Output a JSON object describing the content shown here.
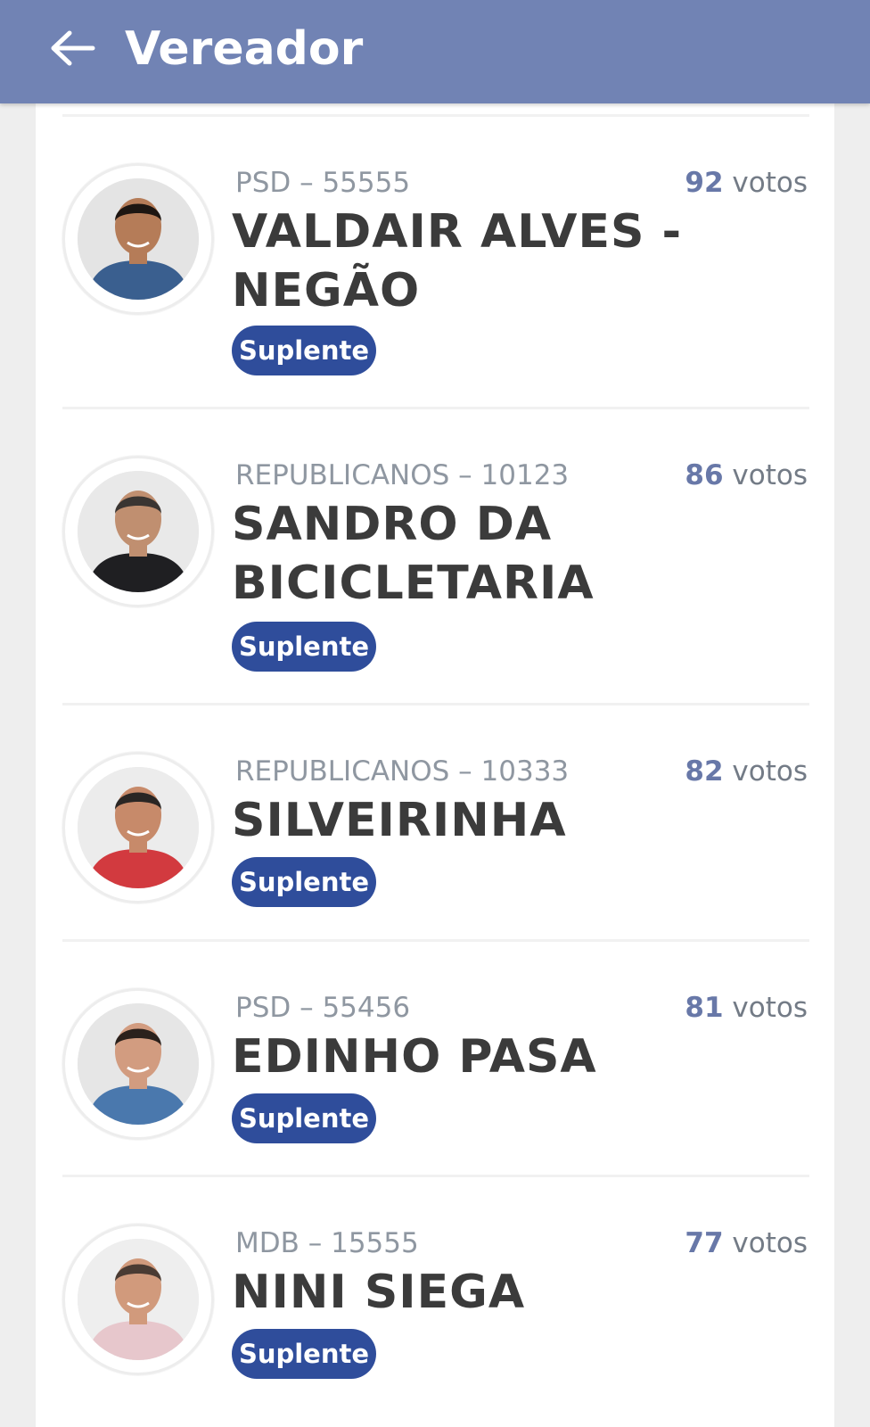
{
  "appbar": {
    "title": "Vereador",
    "back_icon": "arrow-left-icon",
    "color": "#7183b4"
  },
  "candidates": [
    {
      "party": "PSD – 55555",
      "name": "VALDAIR ALVES - NEGÃO",
      "votes": "92",
      "votes_unit": "votos",
      "status": "Suplente",
      "shirt": "#3a5f8f",
      "skin": "#b57c58",
      "hair": "#1d1612",
      "bg": "#e4e4e4"
    },
    {
      "party": "REPUBLICANOS – 10123",
      "name": "SANDRO DA BICICLETARIA",
      "votes": "86",
      "votes_unit": "votos",
      "status": "Suplente",
      "shirt": "#1f1f22",
      "skin": "#c08f70",
      "hair": "#3a3532",
      "bg": "#e9e9e9"
    },
    {
      "party": "REPUBLICANOS – 10333",
      "name": "SILVEIRINHA",
      "votes": "82",
      "votes_unit": "votos",
      "status": "Suplente",
      "shirt": "#d23a3f",
      "skin": "#c78a6a",
      "hair": "#2a2624",
      "bg": "#ececec"
    },
    {
      "party": "PSD – 55456",
      "name": "EDINHO PASA",
      "votes": "81",
      "votes_unit": "votos",
      "status": "Suplente",
      "shirt": "#4a78ad",
      "skin": "#d29c80",
      "hair": "#2b211c",
      "bg": "#e6e6e6"
    },
    {
      "party": "MDB – 15555",
      "name": "NINI SIEGA",
      "votes": "77",
      "votes_unit": "votos",
      "status": "Suplente",
      "shirt": "#e7c7cc",
      "skin": "#d19a7c",
      "hair": "#4a3b33",
      "bg": "#eeeeee"
    }
  ],
  "colors": {
    "badge": "#2f4d9b",
    "votes_number": "#6878a8",
    "name": "#3b3b3b",
    "party": "#8f97a1"
  }
}
